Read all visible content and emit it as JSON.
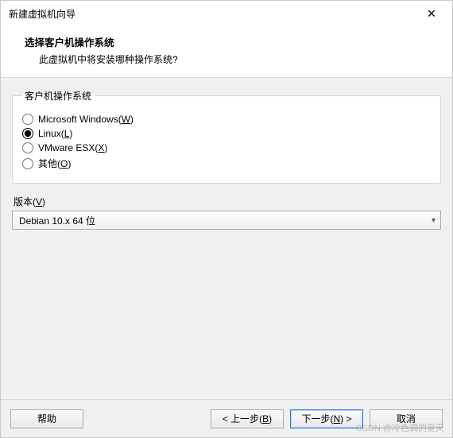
{
  "window": {
    "title": "新建虚拟机向导"
  },
  "header": {
    "heading": "选择客户机操作系统",
    "subtext": "此虚拟机中将安装哪种操作系统?"
  },
  "guest_os": {
    "legend": "客户机操作系统",
    "options": [
      {
        "label_pre": "Microsoft Windows(",
        "hotkey": "W",
        "label_post": ")",
        "checked": false
      },
      {
        "label_pre": "Linux(",
        "hotkey": "L",
        "label_post": ")",
        "checked": true
      },
      {
        "label_pre": "VMware ESX(",
        "hotkey": "X",
        "label_post": ")",
        "checked": false
      },
      {
        "label_pre": "其他(",
        "hotkey": "O",
        "label_post": ")",
        "checked": false
      }
    ]
  },
  "version": {
    "label_pre": "版本(",
    "hotkey": "V",
    "label_post": ")",
    "selected": "Debian 10.x 64 位"
  },
  "buttons": {
    "help": "帮助",
    "back_pre": "< 上一步(",
    "back_hot": "B",
    "back_post": ")",
    "next_pre": "下一步(",
    "next_hot": "N",
    "next_post": ") >",
    "cancel": "取消"
  },
  "watermark": "CSDN @冷色调的夏天"
}
